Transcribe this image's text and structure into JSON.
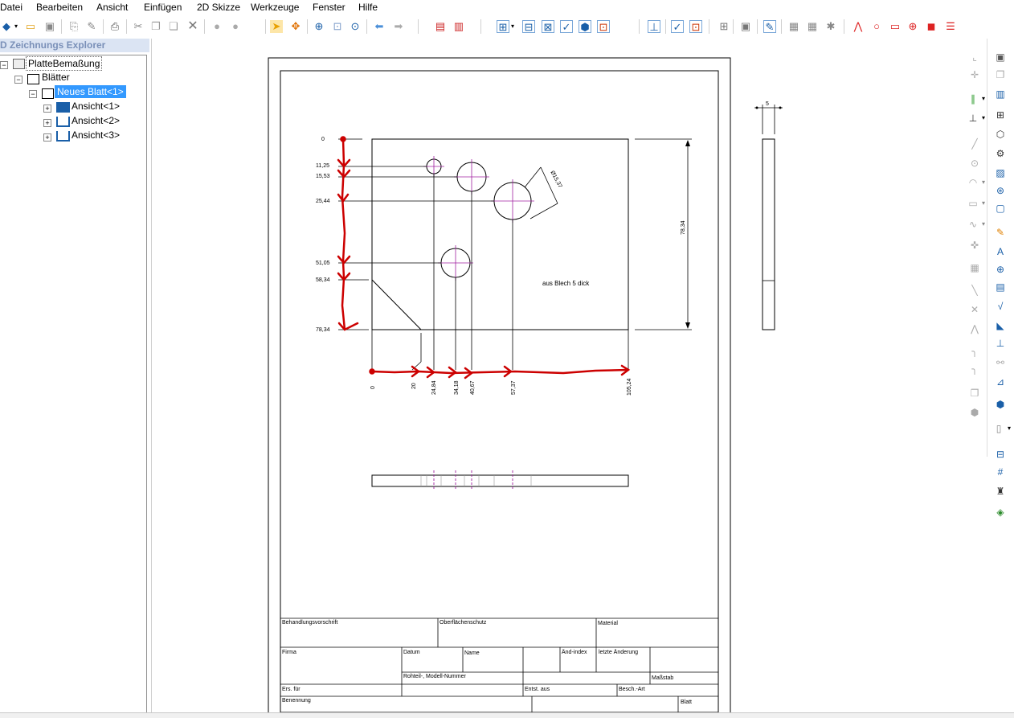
{
  "menu": [
    "Datei",
    "Bearbeiten",
    "Ansicht",
    "Einfügen",
    "2D Skizze",
    "Werkzeuge",
    "Fenster",
    "Hilfe"
  ],
  "explorer": {
    "title": "D Zeichnungs Explorer",
    "tree": {
      "root": "PlatteBemaßung",
      "sheets": "Blätter",
      "sheet": "Neues Blatt<1>",
      "views": [
        "Ansicht<1>",
        "Ansicht<2>",
        "Ansicht<3>"
      ]
    }
  },
  "drawing": {
    "note": "aus Blech 5 dick",
    "vertical_dims": [
      "0",
      "11,25",
      "15,53",
      "25,44",
      "51,05",
      "58,34",
      "78,34"
    ],
    "horizontal_dims": [
      "0",
      "20",
      "24,84",
      "34,18",
      "40,67",
      "57,37",
      "105,24"
    ],
    "height_dim": "78,34",
    "diameter_dim": "Ø15,37",
    "thickness_dim": "5"
  },
  "title_block": {
    "behandlung": "Behandlungsvorschrift",
    "oberflaeche": "Oberflächenschutz",
    "material": "Material",
    "firma": "Firma",
    "datum": "Datum",
    "name": "Name",
    "aend_index": "Änd-index",
    "letzte_aenderung": "letzte Änderung",
    "rohteil": "Rohteil-, Modell-Nummer",
    "massstab": "Maßstab",
    "ers_fuer": "Ers. für",
    "entst_aus": "Entst. aus",
    "besch_art": "Besch.-Art",
    "benennung": "Benennung",
    "blatt": "Blatt"
  },
  "colors": {
    "annotation_red": "#cc0000",
    "centerline_purple": "#a020a0",
    "selection_blue": "#3399ff",
    "explorer_title": "#7a90b8"
  }
}
